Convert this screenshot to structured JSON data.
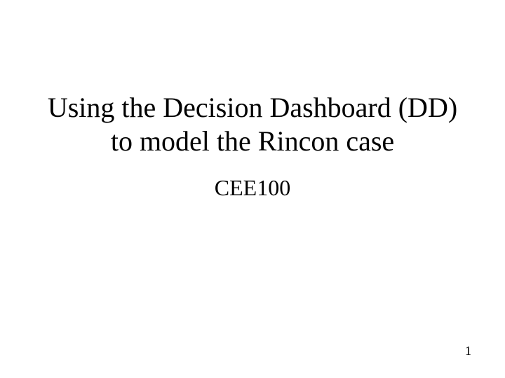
{
  "slide": {
    "title": "Using the Decision Dashboard (DD) to model the Rincon case",
    "subtitle": "CEE100",
    "page_number": "1"
  }
}
